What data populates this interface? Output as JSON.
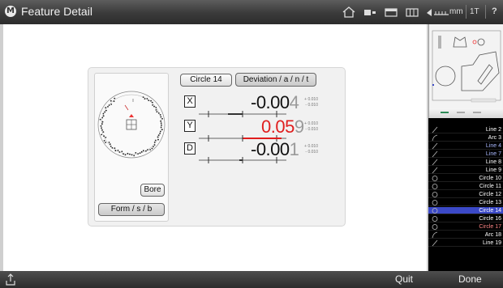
{
  "titlebar": {
    "title": "Feature Detail",
    "logo": "M",
    "icons": [
      "home-icon",
      "probe-icon",
      "window-icon",
      "grid-icon",
      "undo-icon",
      "ruler-icon"
    ],
    "unit": "mm",
    "mode": "1T",
    "help": "?"
  },
  "feature": {
    "name_button": "Circle 14",
    "deviation_button": "Deviation / a / n / t",
    "bore_button": "Bore",
    "form_button": "Form / s / b"
  },
  "measurements": [
    {
      "axis": "X",
      "value_lead": "-0.00",
      "value_tail": "4",
      "tol_plus": "+ 0.010",
      "tol_minus": "- 0.010",
      "out_of_tolerance": false
    },
    {
      "axis": "Y",
      "value_lead": "0.05",
      "value_tail": "9",
      "tol_plus": "+ 0.010",
      "tol_minus": "- 0.010",
      "out_of_tolerance": true
    },
    {
      "axis": "D",
      "value_lead": "-0.00",
      "value_tail": "1",
      "tol_plus": "+ 0.010",
      "tol_minus": "- 0.010",
      "out_of_tolerance": false
    }
  ],
  "feature_list": [
    {
      "label": "Line 2",
      "icon": "line-icon",
      "style": "normal"
    },
    {
      "label": "Arc 3",
      "icon": "arc-icon",
      "style": "normal"
    },
    {
      "label": "Line 4",
      "icon": "line-icon",
      "style": "blue"
    },
    {
      "label": "Line 7",
      "icon": "line-icon",
      "style": "blue"
    },
    {
      "label": "Line 8",
      "icon": "line-icon",
      "style": "normal"
    },
    {
      "label": "Line 9",
      "icon": "line-icon",
      "style": "normal"
    },
    {
      "label": "Circle 10",
      "icon": "circle-icon",
      "style": "normal"
    },
    {
      "label": "Circle 11",
      "icon": "circle-icon",
      "style": "normal"
    },
    {
      "label": "Circle 12",
      "icon": "circle-icon",
      "style": "normal"
    },
    {
      "label": "Circle 13",
      "icon": "circle-icon",
      "style": "normal"
    },
    {
      "label": "Circle 14",
      "icon": "circle-icon",
      "style": "selected"
    },
    {
      "label": "Circle 16",
      "icon": "circle-icon",
      "style": "normal"
    },
    {
      "label": "Circle 17",
      "icon": "circle-icon",
      "style": "red"
    },
    {
      "label": "Arc 18",
      "icon": "arc-icon",
      "style": "normal"
    },
    {
      "label": "Line 19",
      "icon": "line-icon",
      "style": "normal"
    }
  ],
  "bottombar": {
    "quit": "Quit",
    "done": "Done"
  },
  "colors": {
    "out_of_tolerance": "#e01e1e",
    "selected_row": "#3b49c7",
    "list_background": "#000000"
  }
}
